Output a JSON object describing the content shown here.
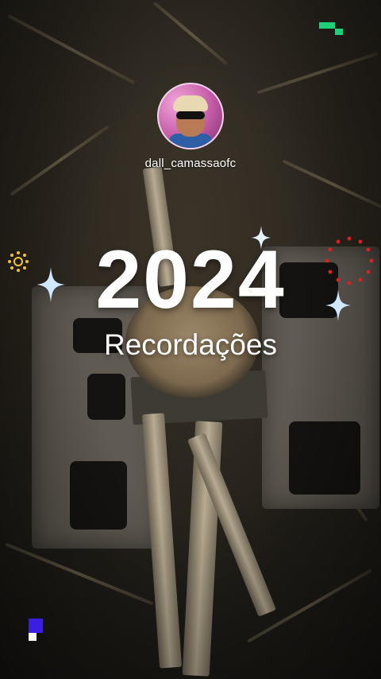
{
  "story": {
    "username": "dall_camassaofc",
    "title": "2024",
    "subtitle": "Recordações"
  },
  "icons": {
    "avatar": "profile-photo",
    "sparkles": [
      "sparkle-icon",
      "sparkle-icon",
      "sparkle-icon"
    ],
    "decorations": [
      "red-dots-ring",
      "yellow-sun",
      "green-pixels",
      "blue-pixels"
    ]
  },
  "colors": {
    "text": "#ffffff",
    "avatar_ring": "#f3d3ec",
    "sparkle": "#cfe8ff",
    "red_dots": "#e0201e",
    "sun": "#f2c230",
    "green_pixel": "#1fd07a",
    "blue_pixel": "#3b1ee0"
  }
}
